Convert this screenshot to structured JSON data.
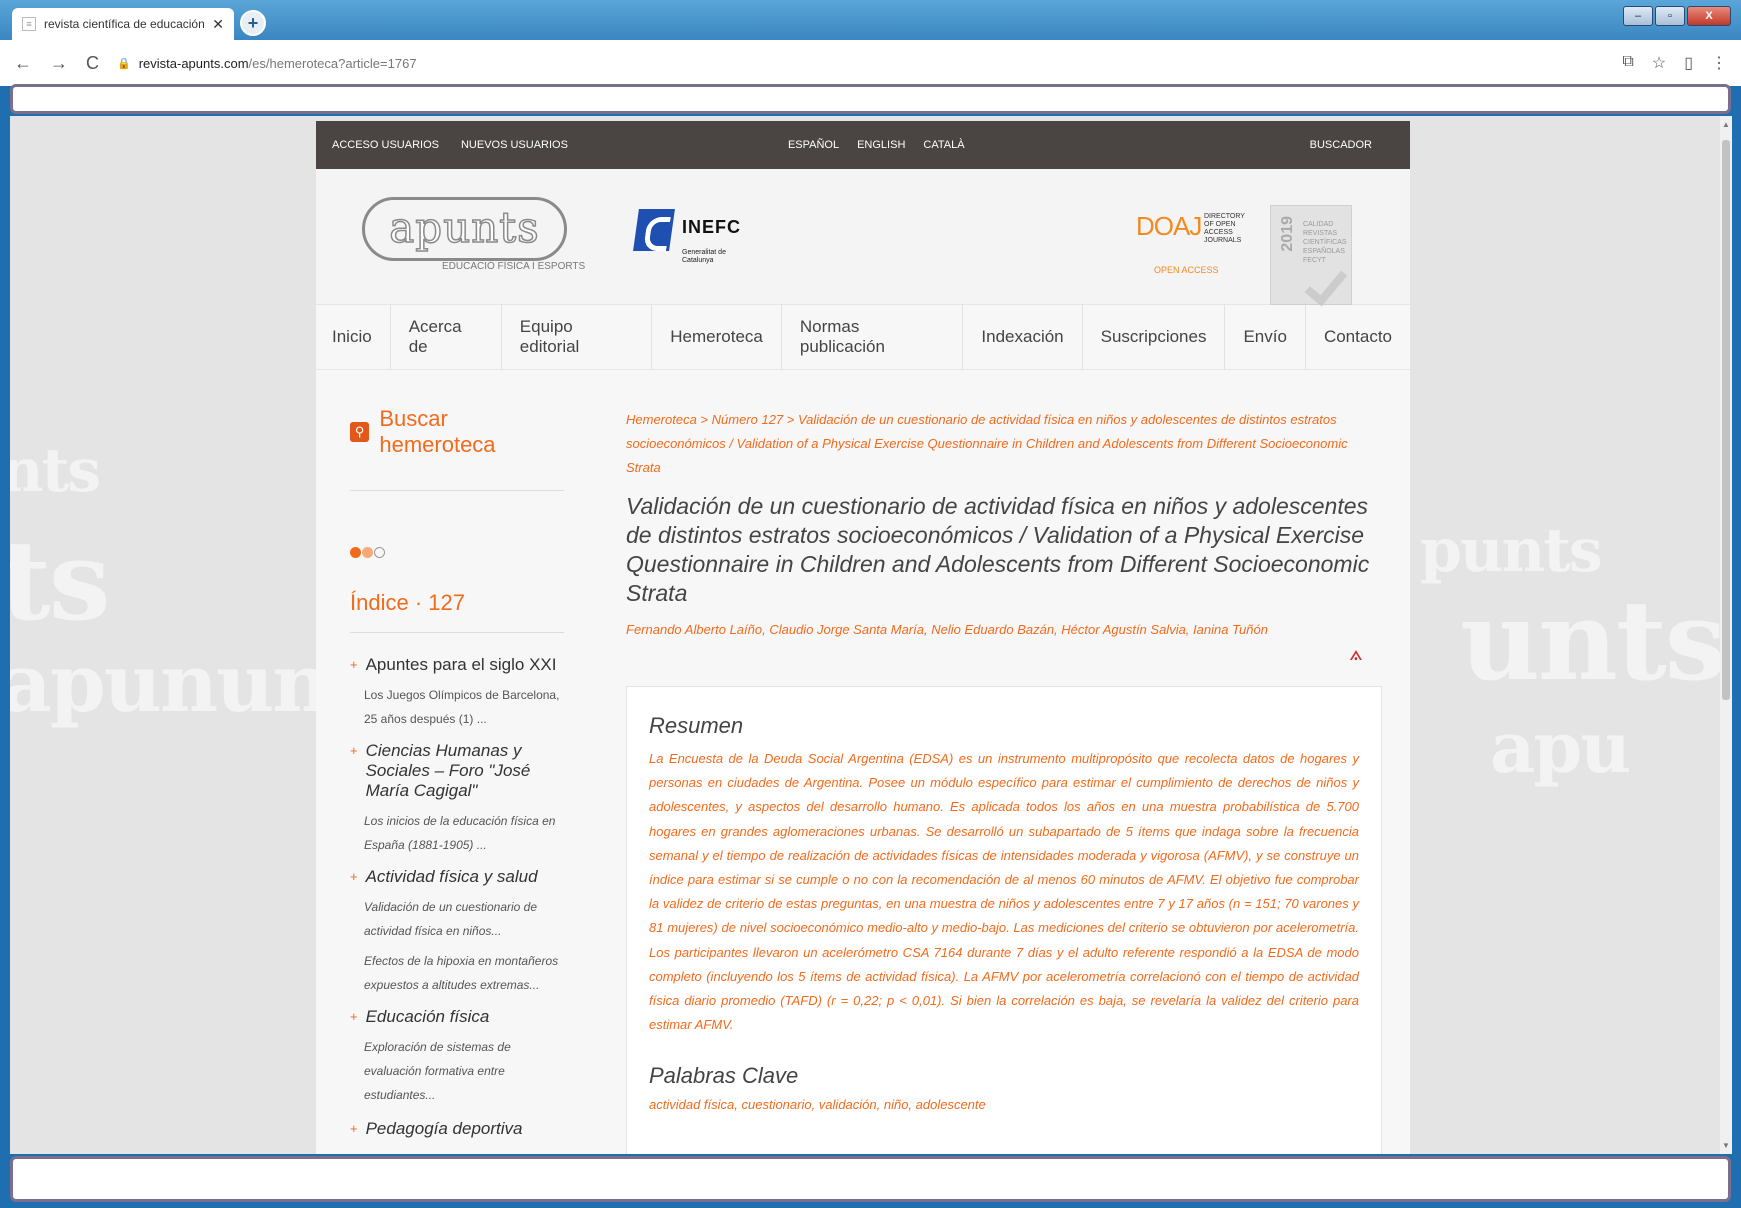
{
  "browser": {
    "tab_title": "revista científica de educación fís",
    "tab_favicon": "page-icon",
    "tab_close": "✕",
    "new_tab": "+",
    "url_host": "revista-apunts.com",
    "url_path": "/es/hemeroteca?article=1767",
    "nav_back": "←",
    "nav_forward": "→",
    "nav_reload": "C",
    "window_minimize": "–",
    "window_restore": "▫",
    "window_close": "X"
  },
  "topbar": {
    "access": "ACCESO USUARIOS",
    "new_users": "NUEVOS USUARIOS",
    "lang_es": "ESPAÑOL",
    "lang_en": "ENGLISH",
    "lang_ca": "CATALÀ",
    "search": "BUSCADOR"
  },
  "header": {
    "logo": "apunts",
    "logo_sub": "EDUCACIÓ FÍSICA I ESPORTS",
    "inefc": "INEFC",
    "generalitat": "Generalitat de Catalunya",
    "doaj": "DOAJ",
    "doaj_sub": "DIRECTORY OF OPEN ACCESS JOURNALS",
    "open_access": "OPEN ACCESS",
    "fecyt_year": "2019",
    "fecyt_text": "CALIDAD REVISTAS CIENTÍFICAS ESPAÑOLAS",
    "fecyt_org": "FECYT"
  },
  "nav": [
    "Inicio",
    "Acerca de",
    "Equipo editorial",
    "Hemeroteca",
    "Normas publicación",
    "Indexación",
    "Suscripciones",
    "Envío",
    "Contacto"
  ],
  "sidebar": {
    "search_title": "Buscar hemeroteca",
    "index_title": "Índice · 127",
    "sections": [
      {
        "title": "Apuntes para el siglo XXI",
        "items": [
          "Los Juegos Olímpicos de Barcelona, 25 años después (1) ..."
        ]
      },
      {
        "title": "Ciencias Humanas y Sociales – Foro \"José María Cagigal\"",
        "items": [
          "Los inicios de la educación física en España (1881-1905) ..."
        ]
      },
      {
        "title": "Actividad física y salud",
        "items": [
          "Validación de un cuestionario de actividad física en niños...",
          "Efectos de la hipoxia en montañeros expuestos a altitudes extremas..."
        ]
      },
      {
        "title": "Educación física",
        "items": [
          "Exploración de sistemas de evaluación formativa entre estudiantes..."
        ]
      },
      {
        "title": "Pedagogía deportiva",
        "items": []
      }
    ]
  },
  "article": {
    "breadcrumb": "Hemeroteca > Número 127 > Validación de un cuestionario de actividad física en niños y adolescentes de distintos estratos socioeconómicos / Validation of a Physical Exercise Questionnaire in Children and Adolescents from Different Socioeconomic Strata",
    "title": "Validación de un cuestionario de actividad física en niños y adolescentes de distintos estratos socioeconómicos / Validation of a Physical Exercise Questionnaire in Children and Adolescents from Different Socioeconomic Strata",
    "authors": "Fernando Alberto Laíño, Claudio Jorge Santa María, Nelio Eduardo Bazán, Héctor Agustín Salvia, Ianina Tuñón",
    "abstract_heading": "Resumen",
    "abstract": "La Encuesta de la Deuda Social Argentina (EDSA) es un instrumento multipropósito que recolecta datos de hogares y personas en ciudades de Argentina. Posee un módulo específico para estimar el cumplimiento de derechos de niños y adolescentes, y aspectos del desarrollo humano. Es aplicada todos los años en una muestra probabilística de 5.700 hogares en grandes aglomeraciones urbanas. Se desarrolló un subapartado de 5 ítems que indaga sobre la frecuencia semanal y el tiempo de realización de actividades físicas de intensidades moderada y vigorosa (AFMV), y se construye un índice para estimar si se cumple o no con la recomendación de al menos 60 minutos de AFMV. El objetivo fue comprobar la validez de criterio de estas preguntas, en una muestra de niños y adolescentes entre 7 y 17 años (n = 151; 70 varones y 81 mujeres) de nivel socioeconómico medio-alto y medio-bajo. Las mediciones del criterio se obtuvieron por acelerometría. Los participantes llevaron un acelerómetro CSA 7164 durante 7 días y el adulto referente respondió a la EDSA de modo completo (incluyendo los 5 ítems de actividad física). La AFMV por acelerometría correlacionó con el tiempo de actividad física diario promedio (TAFD) (r = 0,22; p < 0,01). Si bien la correlación es baja, se revelaría la validez del criterio para estimar AFMV.",
    "keywords_heading": "Palabras Clave",
    "keywords": "actividad física, cuestionario, validación, niño, adolescente"
  },
  "colors": {
    "accent": "#f26a1b",
    "topstrip": "#4a4443",
    "window": "#1f6fb0"
  }
}
